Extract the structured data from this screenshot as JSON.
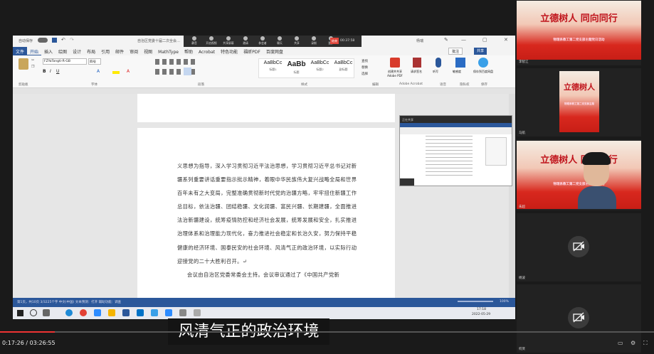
{
  "word": {
    "title": "自治区党委十届二次全会…",
    "autosave": "自动保存",
    "user": "杨瑞",
    "tabs": [
      "文件",
      "开始",
      "插入",
      "绘图",
      "设计",
      "布局",
      "引用",
      "邮件",
      "审阅",
      "视图",
      "MathType",
      "帮助",
      "Acrobat",
      "特色功能",
      "福昕PDF",
      "百度网盘"
    ],
    "comment_btn": "批注",
    "share_btn": "共享",
    "font_name": "FZYaTongti-R-GB",
    "font_size": "四号",
    "styles": [
      "AaBbCc",
      "AaBb",
      "AaBbCc",
      "AaBbCc"
    ],
    "style_names": [
      "标题1",
      "标题",
      "标题2",
      "副标题"
    ],
    "groups": [
      "剪贴板",
      "字体",
      "段落",
      "样式",
      "编辑",
      "Adobe Acrobat",
      "语音",
      "隐私权",
      "保存"
    ],
    "right_tools": [
      "查找",
      "替换",
      "选择",
      "创建并共享Adobe PDF",
      "请求签名",
      "听写",
      "敏感度",
      "保存到百度网盘"
    ],
    "paragraph": "义思想为指导，深入学习贯彻习近平法治思想，学习贯彻习近平总书记对新疆系列重要讲话重要指示批示精神，着眼中华民族伟大复兴战略全局和世界百年未有之大变局，完整准确贯彻新时代党的治疆方略，牢牢扭住新疆工作总目标，依法治疆、团结稳疆、文化润疆、富民兴疆、长期建疆，全面推进法治新疆建设，统筹疫情防控和经济社会发展，统筹发展和安全，扎实推进治理体系和治理能力现代化，奋力推进社会稳定和长治久安，努力保持平稳健康的经济环境、国泰民安的社会环境、风清气正的政治环境，以实际行动迎接党的二十大胜利召开。↵",
    "paragraph2": "会议由自治区党委常委会主持。会议审议通过了《中国共产党新",
    "status": "第1页，共10页  3/3225个字  中文(中国)  文本预测：打开  辅助功能：调查",
    "zoom": "100%"
  },
  "zoom_bar": {
    "items": [
      "静音",
      "开启视频",
      "共享屏幕",
      "邀请",
      "参会者",
      "聊天",
      "共享",
      "录制",
      "更多"
    ],
    "timer": "00:37:58",
    "end": "结束"
  },
  "taskbar": {
    "time": "17:18",
    "date": "2022-05-29"
  },
  "participants": [
    {
      "name": "李智江",
      "banner_title": "立德树人 同向同行",
      "banner_sub": "物理系教工第二党支部主题党日活动",
      "type": "banner"
    },
    {
      "name": "马航",
      "banner_title": "立德树人",
      "banner_sub": "物理系教工第二党支部主题",
      "type": "banner"
    },
    {
      "name": "朱超",
      "banner_title": "立德树人 同向同行",
      "banner_sub": "物理系教工第二党支部主题党日活动",
      "type": "banner-cam"
    },
    {
      "name": "杨波",
      "type": "cam-off"
    },
    {
      "name": "何贤",
      "type": "cam-off"
    }
  ],
  "shared_window_title": "正在共享",
  "subtitle": "风清气正的政治环境",
  "player": {
    "current": "0:17:26",
    "total": "03:26:55",
    "progress": 0.084
  }
}
